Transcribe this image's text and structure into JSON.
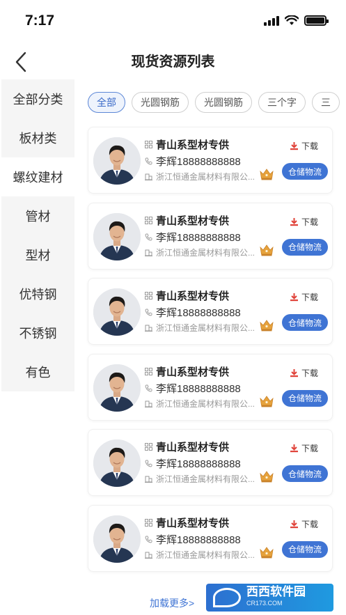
{
  "status_bar": {
    "time": "7:17"
  },
  "nav": {
    "title": "现货资源列表"
  },
  "sidebar": {
    "items": [
      {
        "label": "全部分类"
      },
      {
        "label": "板材类"
      },
      {
        "label": "螺纹建材"
      },
      {
        "label": "管材"
      },
      {
        "label": "型材"
      },
      {
        "label": "优特钢"
      },
      {
        "label": "不锈钢"
      },
      {
        "label": "有色"
      }
    ],
    "active_index": 2
  },
  "filters": {
    "chips": [
      {
        "label": "全部"
      },
      {
        "label": "光圆钢筋"
      },
      {
        "label": "光圆钢筋"
      },
      {
        "label": "三个字"
      },
      {
        "label": "三"
      }
    ],
    "active_index": 0
  },
  "list": {
    "cards": [
      {
        "name": "青山系型材专供",
        "contact": "李辉18888888888",
        "company": "浙江恒通金属材料有限公...",
        "download_label": "下载",
        "button_label": "仓储物流"
      },
      {
        "name": "青山系型材专供",
        "contact": "李辉18888888888",
        "company": "浙江恒通金属材料有限公...",
        "download_label": "下载",
        "button_label": "仓储物流"
      },
      {
        "name": "青山系型材专供",
        "contact": "李辉18888888888",
        "company": "浙江恒通金属材料有限公...",
        "download_label": "下载",
        "button_label": "仓储物流"
      },
      {
        "name": "青山系型材专供",
        "contact": "李辉18888888888",
        "company": "浙江恒通金属材料有限公...",
        "download_label": "下载",
        "button_label": "仓储物流"
      },
      {
        "name": "青山系型材专供",
        "contact": "李辉18888888888",
        "company": "浙江恒通金属材料有限公...",
        "download_label": "下载",
        "button_label": "仓储物流"
      },
      {
        "name": "青山系型材专供",
        "contact": "李辉18888888888",
        "company": "浙江恒通金属材料有限公...",
        "download_label": "下载",
        "button_label": "仓储物流"
      }
    ]
  },
  "footer": {
    "load_more": "加载更多>"
  },
  "watermark": {
    "text": "西西软件园",
    "sub": "CR173.COM"
  },
  "colors": {
    "accent": "#3f74d4",
    "download_icon": "#e0433a",
    "crown": "#e6a23c"
  }
}
